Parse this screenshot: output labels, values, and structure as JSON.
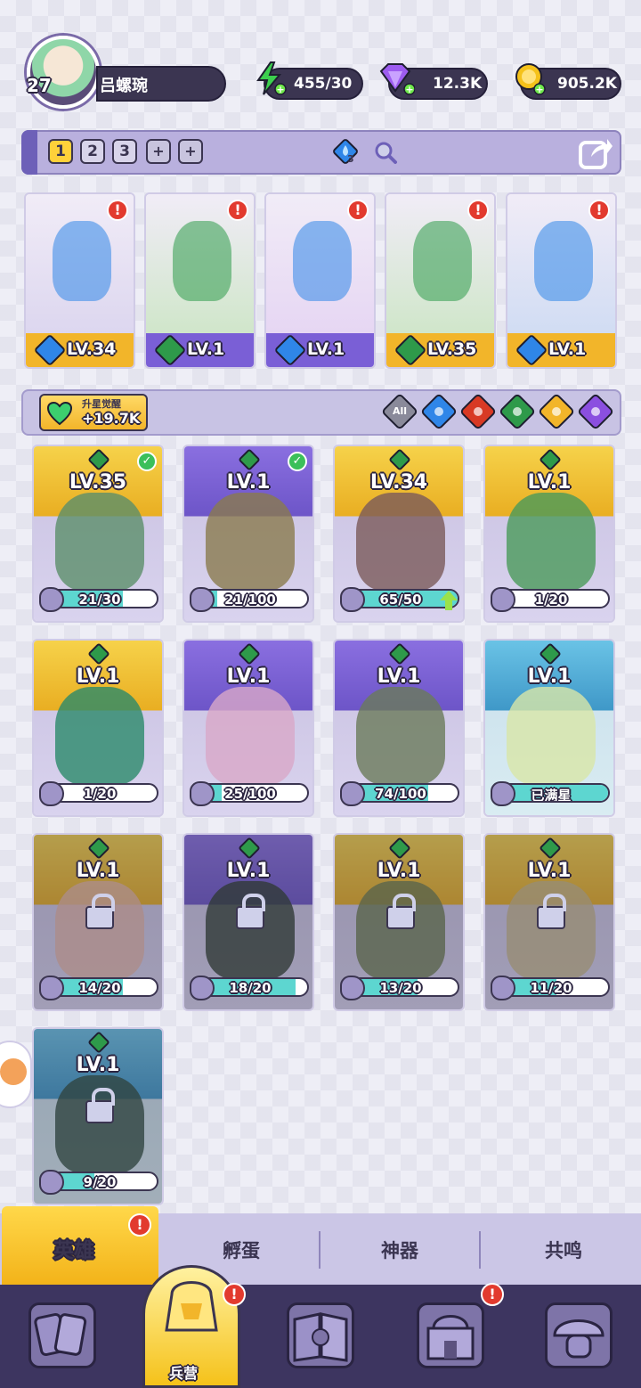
{
  "player": {
    "level": "27",
    "name": "吕螺琬"
  },
  "resources": [
    {
      "name": "energy",
      "value": "455/30",
      "icon": "lightning-icon",
      "color": "#3ccf4e"
    },
    {
      "name": "gems",
      "value": "12.3K",
      "icon": "diamond-icon",
      "color": "#9d5cf0"
    },
    {
      "name": "gold",
      "value": "905.2K",
      "icon": "coin-icon",
      "color": "#f5c21a"
    }
  ],
  "team_slots": [
    "1",
    "2",
    "3",
    "+",
    "+"
  ],
  "team_tool": {
    "water_badge_count": "3"
  },
  "team": [
    {
      "level": "LV.34",
      "element": "water",
      "alert": "!"
    },
    {
      "level": "LV.1",
      "element": "nature",
      "alert": "!"
    },
    {
      "level": "LV.1",
      "element": "water",
      "alert": "!"
    },
    {
      "level": "LV.35",
      "element": "nature",
      "alert": "!"
    },
    {
      "level": "LV.1",
      "element": "water",
      "alert": "!"
    }
  ],
  "awaken": {
    "label": "升星觉醒",
    "value": "+19.7K"
  },
  "filters": [
    {
      "label": "All",
      "color": "#8a8a9a"
    },
    {
      "label": "",
      "color": "#2f86e8"
    },
    {
      "label": "",
      "color": "#d83a24"
    },
    {
      "label": "",
      "color": "#2e9a4a"
    },
    {
      "label": "",
      "color": "#f2b52a"
    },
    {
      "label": "",
      "color": "#8b4fe0"
    }
  ],
  "heroes": [
    {
      "level": "LV.35",
      "progress": "21/30",
      "fill": 0.7,
      "bg": "gold",
      "checked": true,
      "locked": false
    },
    {
      "level": "LV.1",
      "progress": "21/100",
      "fill": 0.21,
      "bg": "purple",
      "checked": true,
      "locked": false
    },
    {
      "level": "LV.34",
      "progress": "65/50",
      "fill": 1.0,
      "bg": "gold",
      "checked": false,
      "locked": false,
      "upgrade": true
    },
    {
      "level": "LV.1",
      "progress": "1/20",
      "fill": 0.05,
      "bg": "gold",
      "checked": false,
      "locked": false
    },
    {
      "level": "LV.1",
      "progress": "1/20",
      "fill": 0.05,
      "bg": "gold",
      "checked": false,
      "locked": false
    },
    {
      "level": "LV.1",
      "progress": "25/100",
      "fill": 0.25,
      "bg": "purple",
      "checked": false,
      "locked": false
    },
    {
      "level": "LV.1",
      "progress": "74/100",
      "fill": 0.74,
      "bg": "purple",
      "checked": false,
      "locked": false
    },
    {
      "level": "LV.1",
      "progress": "已满星",
      "fill": 1.0,
      "bg": "blue",
      "checked": false,
      "locked": false
    },
    {
      "level": "LV.1",
      "progress": "14/20",
      "fill": 0.7,
      "bg": "gold",
      "checked": false,
      "locked": true
    },
    {
      "level": "LV.1",
      "progress": "18/20",
      "fill": 0.9,
      "bg": "purple",
      "checked": false,
      "locked": true
    },
    {
      "level": "LV.1",
      "progress": "13/20",
      "fill": 0.65,
      "bg": "gold",
      "checked": false,
      "locked": true
    },
    {
      "level": "LV.1",
      "progress": "11/20",
      "fill": 0.55,
      "bg": "gold",
      "checked": false,
      "locked": true
    },
    {
      "level": "LV.1",
      "progress": "9/20",
      "fill": 0.45,
      "bg": "blue",
      "checked": false,
      "locked": true
    }
  ],
  "subtabs": [
    "英雄",
    "孵蛋",
    "神器",
    "共鸣"
  ],
  "subtab_alert": "!",
  "bottom_nav": {
    "active_label": "兵营",
    "alert": "!"
  }
}
